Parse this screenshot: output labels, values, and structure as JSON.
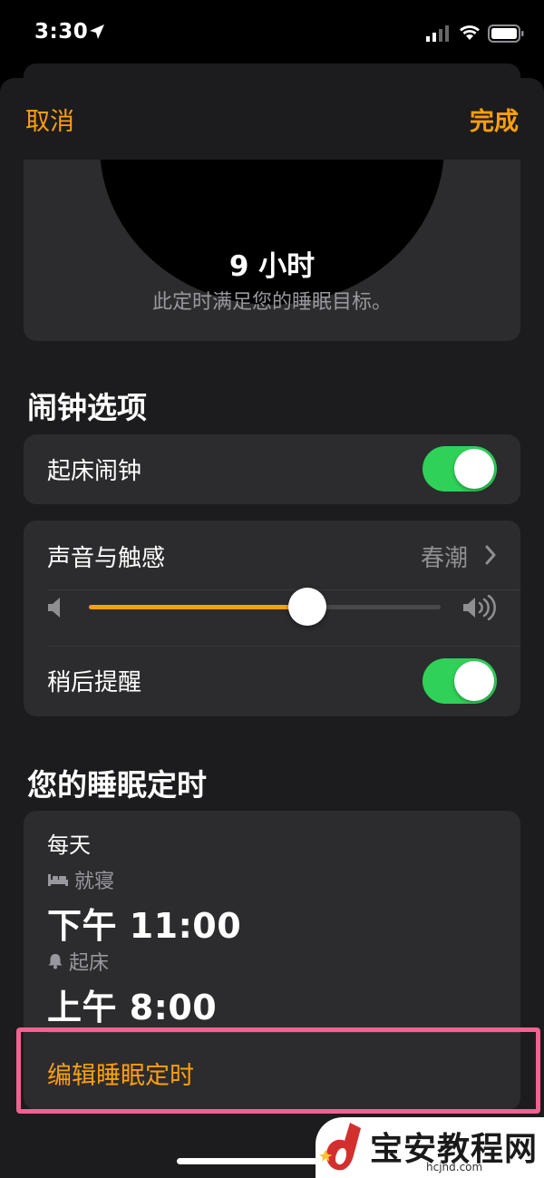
{
  "status_bar": {
    "time": "3:30"
  },
  "nav": {
    "cancel_label": "取消",
    "done_label": "完成"
  },
  "clock": {
    "duration": "9 小时",
    "note": "此定时满足您的睡眠目标。"
  },
  "alarm_options": {
    "title": "闹钟选项",
    "wake_alarm": {
      "label": "起床闹钟",
      "on": true
    },
    "sound": {
      "label": "声音与触感",
      "value": "春潮"
    },
    "volume": {
      "level": 0.62
    },
    "snooze": {
      "label": "稍后提醒",
      "on": true
    }
  },
  "schedule": {
    "title": "您的睡眠定时",
    "days": "每天",
    "bedtime": {
      "label": "就寝",
      "time": "下午 11:00"
    },
    "wakeup": {
      "label": "起床",
      "time": "上午 8:00"
    },
    "edit_label": "编辑睡眠定时"
  },
  "watermark": {
    "name": "宝安教程网",
    "url": "hcjhd.com"
  },
  "colors": {
    "accent": "#ff9f0a",
    "toggle_on": "#30d158",
    "highlight": "#f06292"
  },
  "icons": [
    "location-arrow-icon",
    "cellular-signal-icon",
    "wifi-icon",
    "battery-icon",
    "speaker-low-icon",
    "speaker-high-icon",
    "chevron-right-icon",
    "bed-icon",
    "bell-icon"
  ]
}
